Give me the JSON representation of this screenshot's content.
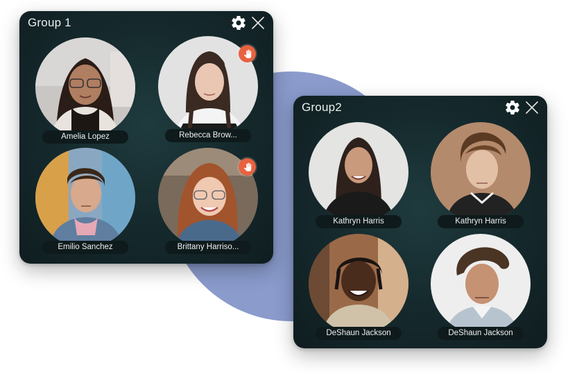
{
  "groups": [
    {
      "title": "Group 1",
      "participants": [
        {
          "name": "Amelia Lopez",
          "hand_raised": false
        },
        {
          "name": "Rebecca Brow...",
          "hand_raised": true
        },
        {
          "name": "Emilio Sanchez",
          "hand_raised": false
        },
        {
          "name": "Brittany Harriso...",
          "hand_raised": true
        }
      ]
    },
    {
      "title": "Group2",
      "participants": [
        {
          "name": "Kathryn Harris",
          "hand_raised": false
        },
        {
          "name": "Kathryn Harris",
          "hand_raised": false
        },
        {
          "name": "DeShaun Jackson",
          "hand_raised": false
        },
        {
          "name": "DeShaun Jackson",
          "hand_raised": false
        }
      ]
    }
  ],
  "icons": {
    "settings": "gear-icon",
    "close": "close-icon",
    "hand": "raised-hand-icon"
  },
  "colors": {
    "panel_bg": "#162b2e",
    "name_chip_bg": "#0e1a1c",
    "hand_badge": "#e8623f",
    "backdrop_circle": "#8a9bcc"
  }
}
